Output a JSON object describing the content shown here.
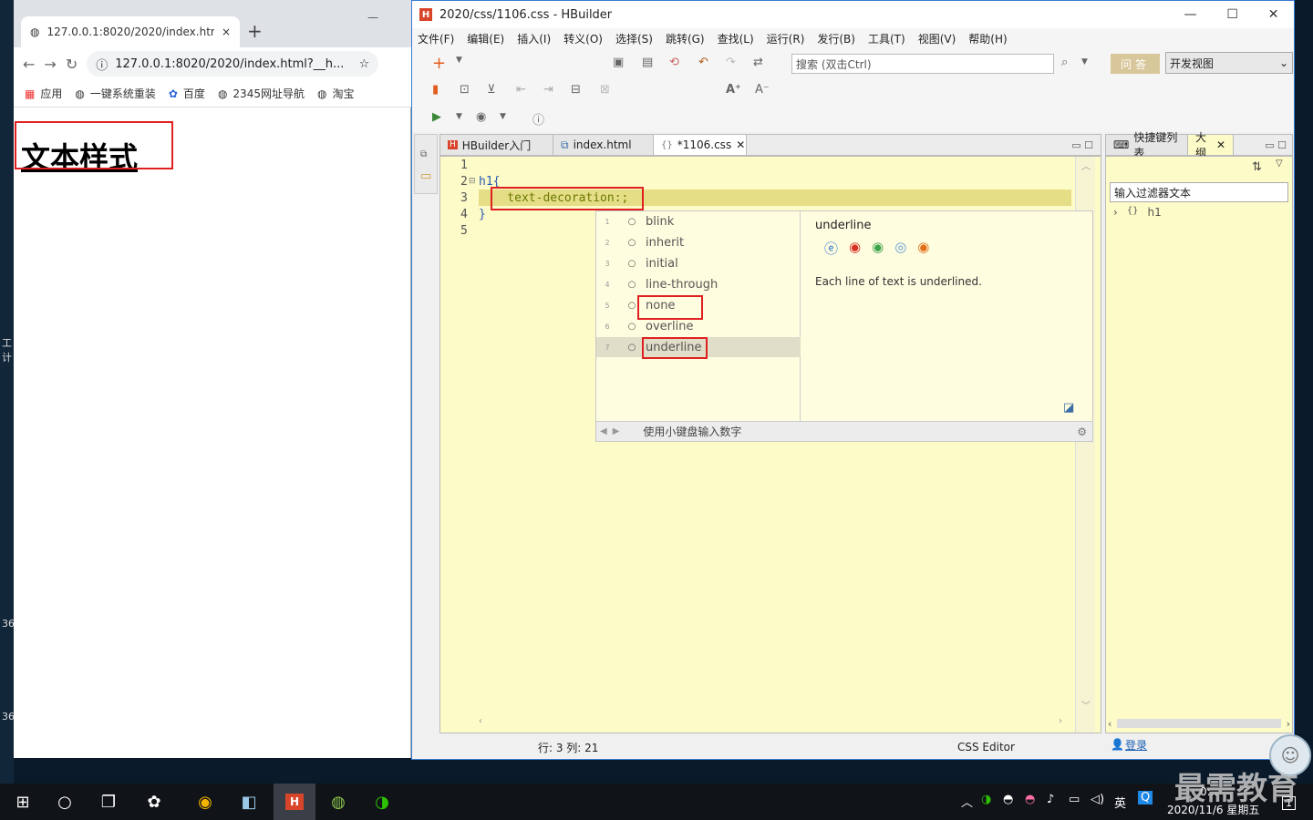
{
  "desktop": {
    "strip": [
      "工",
      "计",
      "36",
      "36"
    ]
  },
  "browser": {
    "tab_title": "127.0.0.1:8020/2020/index.htm",
    "tab_close": "×",
    "new_tab": "+",
    "minimize": "—",
    "url": "127.0.0.1:8020/2020/index.html?__h...",
    "bookmarks": [
      "应用",
      "一键系统重装",
      "百度",
      "2345网址导航",
      "淘宝"
    ],
    "heading": "文本样式"
  },
  "hbuilder": {
    "title": "2020/css/1106.css  -  HBuilder",
    "logo": "H",
    "menu": [
      "文件(F)",
      "编辑(E)",
      "插入(I)",
      "转义(O)",
      "选择(S)",
      "跳转(G)",
      "查找(L)",
      "运行(R)",
      "发行(B)",
      "工具(T)",
      "视图(V)",
      "帮助(H)"
    ],
    "search_placeholder": "搜索 (双击Ctrl)",
    "qa_label": "问答",
    "view_select": "开发视图",
    "editor_tabs": [
      {
        "label": "HBuilder入门",
        "icon": "H"
      },
      {
        "label": "index.html",
        "icon": "⧉"
      },
      {
        "label": "*1106.css",
        "icon": "{}"
      }
    ],
    "code_lines": [
      {
        "num": "1",
        "text": ""
      },
      {
        "num": "2",
        "text": "h1{"
      },
      {
        "num": "3",
        "text": "    text-decoration:;"
      },
      {
        "num": "4",
        "text": "}"
      },
      {
        "num": "5",
        "text": ""
      }
    ],
    "assist": {
      "items": [
        {
          "num": "1",
          "label": "blink"
        },
        {
          "num": "2",
          "label": "inherit"
        },
        {
          "num": "3",
          "label": "initial"
        },
        {
          "num": "4",
          "label": "line-through"
        },
        {
          "num": "5",
          "label": "none"
        },
        {
          "num": "6",
          "label": "overline"
        },
        {
          "num": "7",
          "label": "underline"
        }
      ],
      "doc_title": "underline",
      "doc_text": "Each line of text is underlined.",
      "footer": "使用小键盘输入数字"
    },
    "outline": {
      "tabs": [
        "快捷键列表",
        "大纲"
      ],
      "filter": "输入过滤器文本",
      "item": "h1",
      "login": "登录"
    },
    "status": {
      "position": "行: 3 列: 21",
      "editor": "CSS Editor"
    }
  },
  "taskbar": {
    "ime": "英",
    "time": "0:..",
    "date": "2020/11/6 星期五",
    "notif_count": "1"
  },
  "watermark": "最需教育"
}
